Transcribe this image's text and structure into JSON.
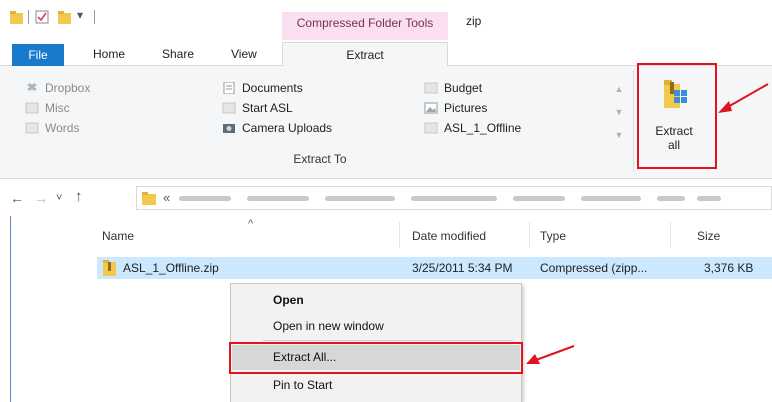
{
  "window": {
    "title": "zip",
    "context_tab_group": "Compressed Folder Tools"
  },
  "ribbon_tabs": {
    "file": "File",
    "home": "Home",
    "share": "Share",
    "view": "View",
    "extract": "Extract"
  },
  "gallery": {
    "col1": [
      "Dropbox",
      "Misc",
      "Words"
    ],
    "col2": [
      "Documents",
      "Start ASL",
      "Camera Uploads"
    ],
    "col3": [
      "Budget",
      "Pictures",
      "ASL_1_Offline"
    ],
    "group_label": "Extract To",
    "scroll_up": "▲",
    "scroll_down": "▼",
    "scroll_more": "▼"
  },
  "extract_all_button": {
    "label_line1": "Extract",
    "label_line2": "all"
  },
  "address_bar": {
    "overflow": "«",
    "up_glyph": "↑",
    "back_glyph": "←",
    "forward_glyph": "→",
    "recent_glyph": "˅"
  },
  "columns": {
    "name": "Name",
    "date_modified": "Date modified",
    "type": "Type",
    "size": "Size",
    "sort_glyph": "^"
  },
  "file_row": {
    "name": "ASL_1_Offline.zip",
    "date_modified": "3/25/2011 5:34 PM",
    "type": "Compressed (zipp...",
    "size": "3,376 KB"
  },
  "context_menu": {
    "open": "Open",
    "open_new_window": "Open in new window",
    "extract_all": "Extract All...",
    "pin_to_start": "Pin to Start"
  },
  "colors": {
    "accent_blue": "#1979ca",
    "context_pink": "#f9dff0",
    "highlight_red": "#e0141f",
    "selection_blue": "#cce8ff"
  }
}
